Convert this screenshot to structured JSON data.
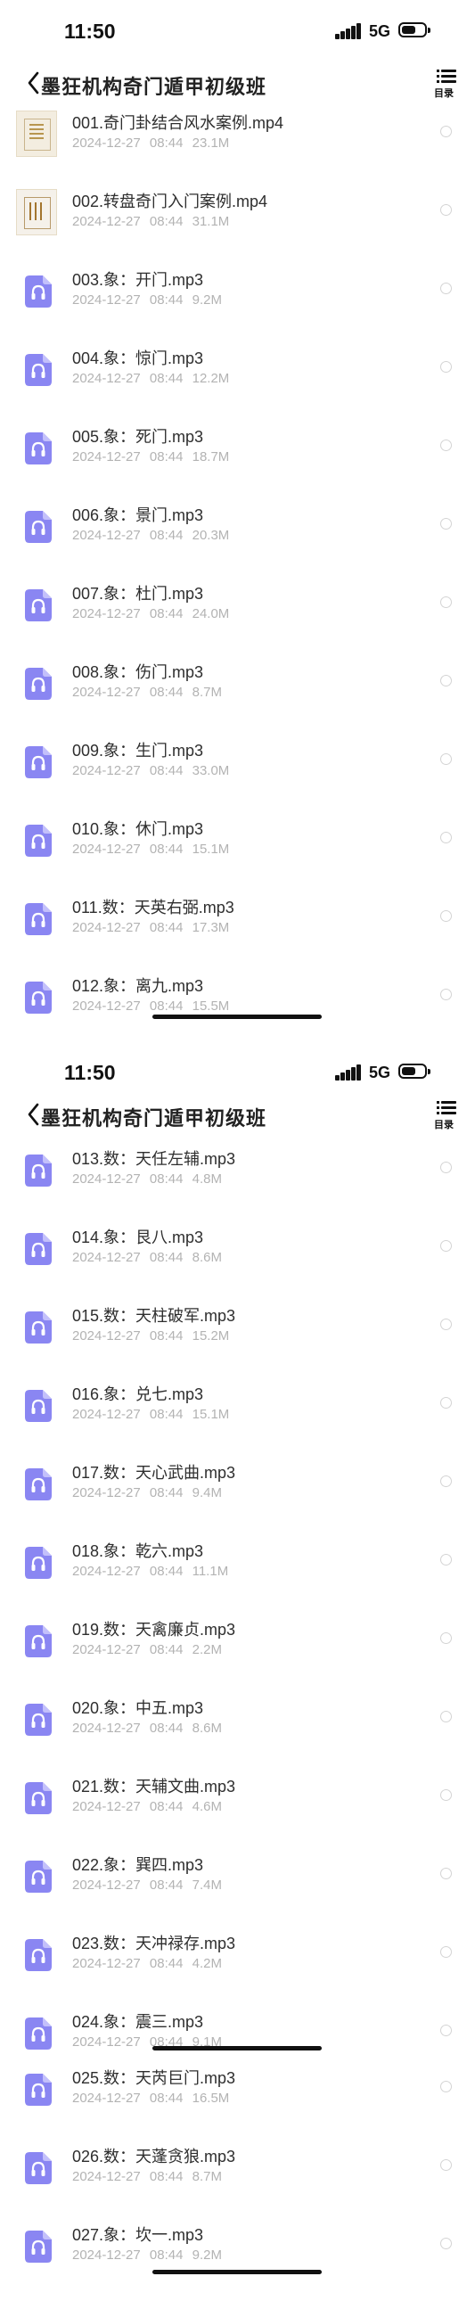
{
  "status_bar": {
    "time": "11:50",
    "network": "5G",
    "battery_icon": "battery-icon",
    "signal_icon": "signal-icon"
  },
  "nav": {
    "title": "墨狂机构奇门遁甲初级班",
    "menu_label": "目录",
    "back_icon": "chevron-left-icon",
    "menu_icon": "list-icon"
  },
  "colors": {
    "audio_icon": "#8a86f2",
    "meta_text": "#b3b3b3",
    "radio_border": "#d4d4d4"
  },
  "items": [
    {
      "name": "001.奇门卦结合风水案例.mp4",
      "date": "2024-12-27 08:44",
      "size": "23.1M",
      "kind": "video"
    },
    {
      "name": "002.转盘奇门入门案例.mp4",
      "date": "2024-12-27 08:44",
      "size": "31.1M",
      "kind": "video"
    },
    {
      "name": "003.象：开门.mp3",
      "date": "2024-12-27 08:44",
      "size": "9.2M",
      "kind": "audio"
    },
    {
      "name": "004.象：惊门.mp3",
      "date": "2024-12-27 08:44",
      "size": "12.2M",
      "kind": "audio"
    },
    {
      "name": "005.象：死门.mp3",
      "date": "2024-12-27 08:44",
      "size": "18.7M",
      "kind": "audio"
    },
    {
      "name": "006.象：景门.mp3",
      "date": "2024-12-27 08:44",
      "size": "20.3M",
      "kind": "audio"
    },
    {
      "name": "007.象：杜门.mp3",
      "date": "2024-12-27 08:44",
      "size": "24.0M",
      "kind": "audio"
    },
    {
      "name": "008.象：伤门.mp3",
      "date": "2024-12-27 08:44",
      "size": "8.7M",
      "kind": "audio"
    },
    {
      "name": "009.象：生门.mp3",
      "date": "2024-12-27 08:44",
      "size": "33.0M",
      "kind": "audio"
    },
    {
      "name": "010.象：休门.mp3",
      "date": "2024-12-27 08:44",
      "size": "15.1M",
      "kind": "audio"
    },
    {
      "name": "011.数：天英右弼.mp3",
      "date": "2024-12-27 08:44",
      "size": "17.3M",
      "kind": "audio"
    },
    {
      "name": "012.象：离九.mp3",
      "date": "2024-12-27 08:44",
      "size": "15.5M",
      "kind": "audio"
    },
    {
      "name": "013.数：天任左辅.mp3",
      "date": "2024-12-27 08:44",
      "size": "4.8M",
      "kind": "audio"
    },
    {
      "name": "014.象：艮八.mp3",
      "date": "2024-12-27 08:44",
      "size": "8.6M",
      "kind": "audio"
    },
    {
      "name": "015.数：天柱破军.mp3",
      "date": "2024-12-27 08:44",
      "size": "15.2M",
      "kind": "audio"
    },
    {
      "name": "016.象：兑七.mp3",
      "date": "2024-12-27 08:44",
      "size": "15.1M",
      "kind": "audio"
    },
    {
      "name": "017.数：天心武曲.mp3",
      "date": "2024-12-27 08:44",
      "size": "9.4M",
      "kind": "audio"
    },
    {
      "name": "018.象：乾六.mp3",
      "date": "2024-12-27 08:44",
      "size": "11.1M",
      "kind": "audio"
    },
    {
      "name": "019.数：天禽廉贞.mp3",
      "date": "2024-12-27 08:44",
      "size": "2.2M",
      "kind": "audio"
    },
    {
      "name": "020.象：中五.mp3",
      "date": "2024-12-27 08:44",
      "size": "8.6M",
      "kind": "audio"
    },
    {
      "name": "021.数：天辅文曲.mp3",
      "date": "2024-12-27 08:44",
      "size": "4.6M",
      "kind": "audio"
    },
    {
      "name": "022.象：巽四.mp3",
      "date": "2024-12-27 08:44",
      "size": "7.4M",
      "kind": "audio"
    },
    {
      "name": "023.数：天冲禄存.mp3",
      "date": "2024-12-27 08:44",
      "size": "4.2M",
      "kind": "audio"
    },
    {
      "name": "024.象：震三.mp3",
      "date": "2024-12-27 08:44",
      "size": "9.1M",
      "kind": "audio"
    },
    {
      "name": "025.数：天芮巨门.mp3",
      "date": "2024-12-27 08:44",
      "size": "16.5M",
      "kind": "audio"
    },
    {
      "name": "026.数：天蓬贪狼.mp3",
      "date": "2024-12-27 08:44",
      "size": "8.7M",
      "kind": "audio"
    },
    {
      "name": "027.象：坎一.mp3",
      "date": "2024-12-27 08:44",
      "size": "9.2M",
      "kind": "audio"
    }
  ]
}
